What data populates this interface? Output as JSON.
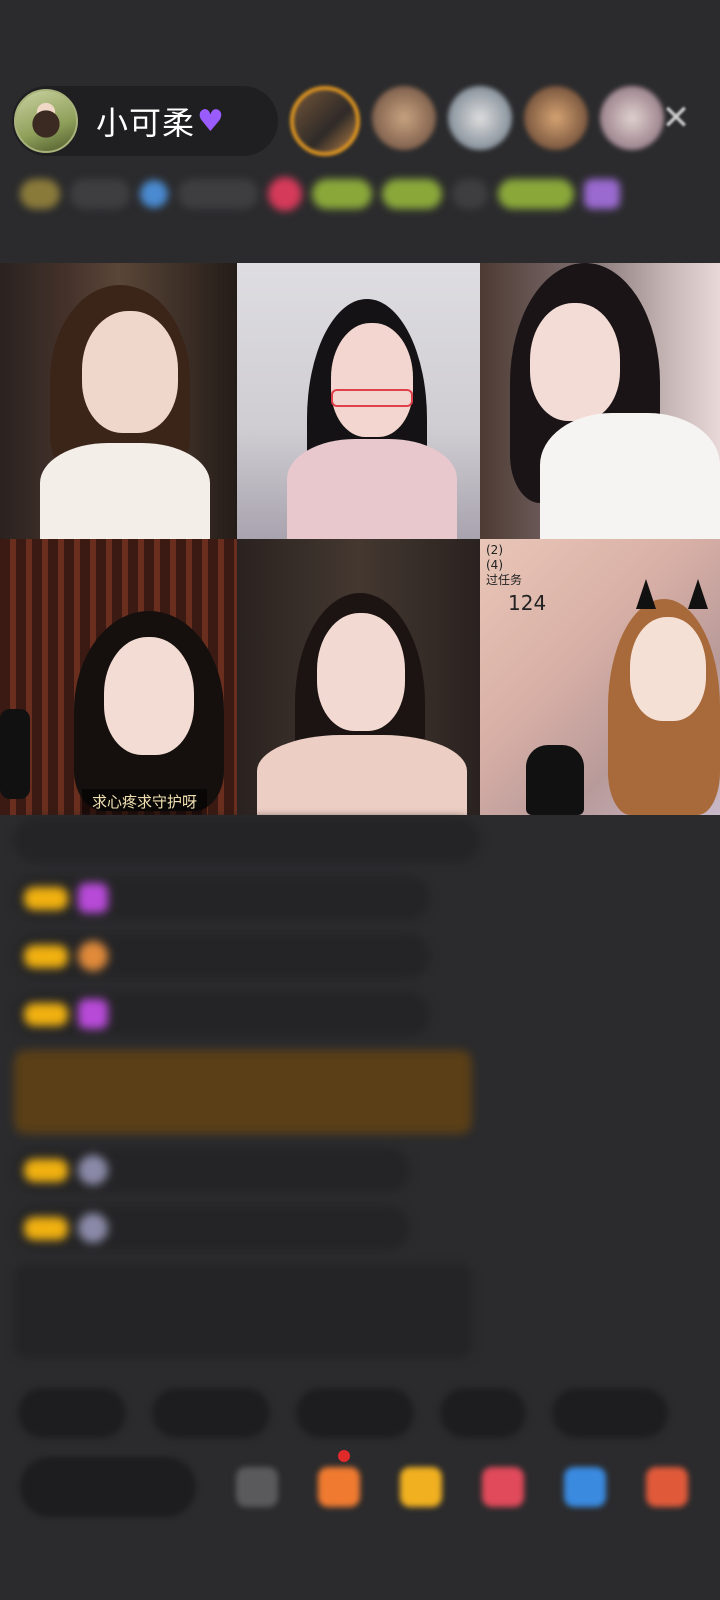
{
  "host": {
    "name": "小可柔",
    "heart_icon": "purple-heart-icon"
  },
  "header": {
    "close_icon": "close-icon",
    "viewer_avatar_count": 5
  },
  "tiles": [
    {
      "id": 1,
      "caption": ""
    },
    {
      "id": 2,
      "caption": ""
    },
    {
      "id": 3,
      "caption": ""
    },
    {
      "id": 4,
      "caption": "求心疼求守护呀"
    },
    {
      "id": 5,
      "caption": ""
    },
    {
      "id": 6,
      "counter_lines": [
        "(2)",
        "(4)",
        "过任务"
      ],
      "count": "124"
    }
  ],
  "colors": {
    "background": "#2b2b2d",
    "badge": "#f0b010",
    "accent_purple": "#9b5cff"
  }
}
